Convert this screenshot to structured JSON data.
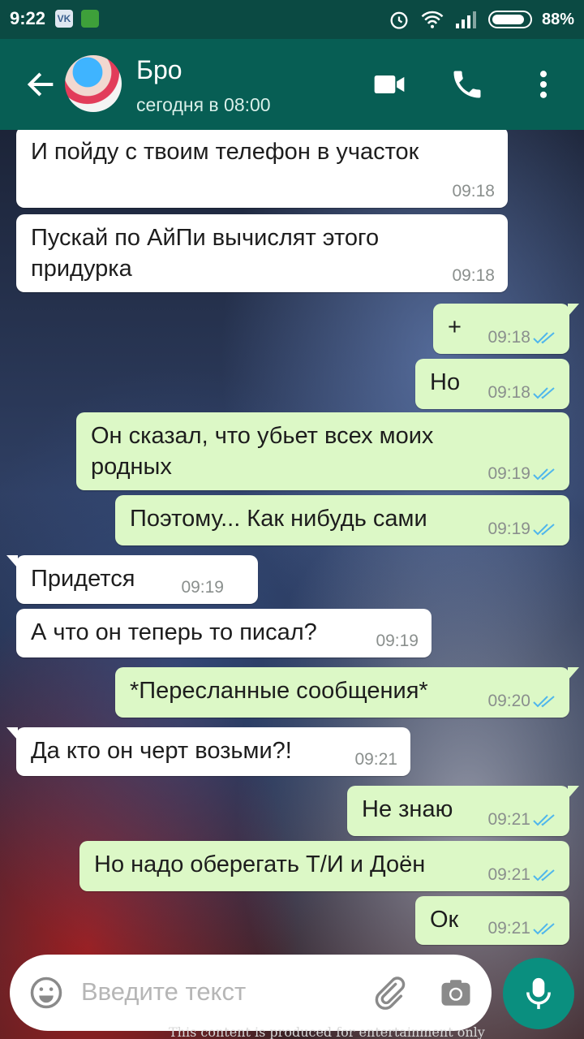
{
  "status_bar": {
    "time": "9:22",
    "app_icon_1": "VK",
    "battery_percent": "88%",
    "battery_level": 0.88
  },
  "header": {
    "back_icon": "arrow-left-icon",
    "contact_name": "Бро",
    "last_seen": "сегодня в 08:00"
  },
  "messages": [
    {
      "dir": "in",
      "text": "И пойду с твоим телефон в участок",
      "time": "09:18"
    },
    {
      "dir": "in",
      "text": "Пускай по АйПи вычислят этого придурка",
      "time": "09:18"
    },
    {
      "dir": "out",
      "text": "+",
      "time": "09:18",
      "read": true
    },
    {
      "dir": "out",
      "text": "Но",
      "time": "09:18",
      "read": true
    },
    {
      "dir": "out",
      "text": "Он сказал, что убьет всех моих родных",
      "time": "09:19",
      "read": true
    },
    {
      "dir": "out",
      "text": "Поэтому... Как нибудь сами",
      "time": "09:19",
      "read": true
    },
    {
      "dir": "in",
      "text": "Придется",
      "time": "09:19"
    },
    {
      "dir": "in",
      "text": "А что он теперь то писал?",
      "time": "09:19"
    },
    {
      "dir": "out",
      "text": "*Пересланные сообщения*",
      "time": "09:20",
      "read": true
    },
    {
      "dir": "in",
      "text": "Да кто он черт возьми?!",
      "time": "09:21"
    },
    {
      "dir": "out",
      "text": "Не знаю",
      "time": "09:21",
      "read": true
    },
    {
      "dir": "out",
      "text": "Но надо оберегать Т/И и Доён",
      "time": "09:21",
      "read": true
    },
    {
      "dir": "out",
      "text": "Ок",
      "time": "09:21",
      "read": true
    }
  ],
  "wallpaper": {
    "caption": "This content is produced for entertainment only"
  },
  "input": {
    "placeholder": "Введите текст"
  },
  "colors": {
    "header": "#075e54",
    "status_bar": "#0b4a43",
    "outgoing_bubble": "#dcf8c6",
    "incoming_bubble": "#ffffff",
    "read_ticks": "#4fb6ec",
    "mic_button": "#0a8f7f"
  }
}
